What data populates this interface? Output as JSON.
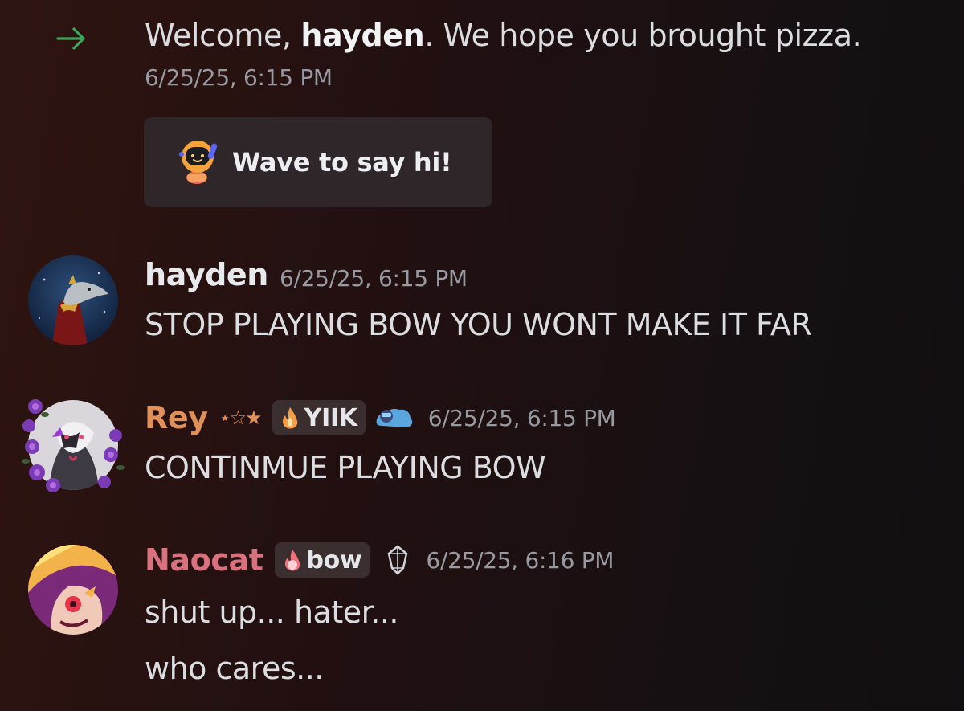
{
  "system_message": {
    "prefix": "Welcome, ",
    "username": "hayden",
    "suffix": ". We hope you brought pizza.",
    "timestamp": "6/25/25, 6:15 PM",
    "wave_button_label": "Wave to say hi!",
    "arrow_color": "#3ba55d"
  },
  "messages": [
    {
      "username": "hayden",
      "name_color": "#e8e9ec",
      "timestamp": "6/25/25, 6:15 PM",
      "lines": [
        "STOP PLAYING BOW YOU WONT MAKE IT FAR"
      ]
    },
    {
      "username": "Rey",
      "name_color": "#e0915a",
      "decoration": "⋆☆★",
      "tag": "YIIK",
      "timestamp": "6/25/25, 6:15 PM",
      "lines": [
        "CONTINMUE PLAYING BOW"
      ]
    },
    {
      "username": "Naocat",
      "name_color": "#d9727e",
      "tag": "bow",
      "timestamp": "6/25/25, 6:16 PM",
      "lines": [
        "shut up... hater...",
        "who cares..."
      ]
    }
  ]
}
